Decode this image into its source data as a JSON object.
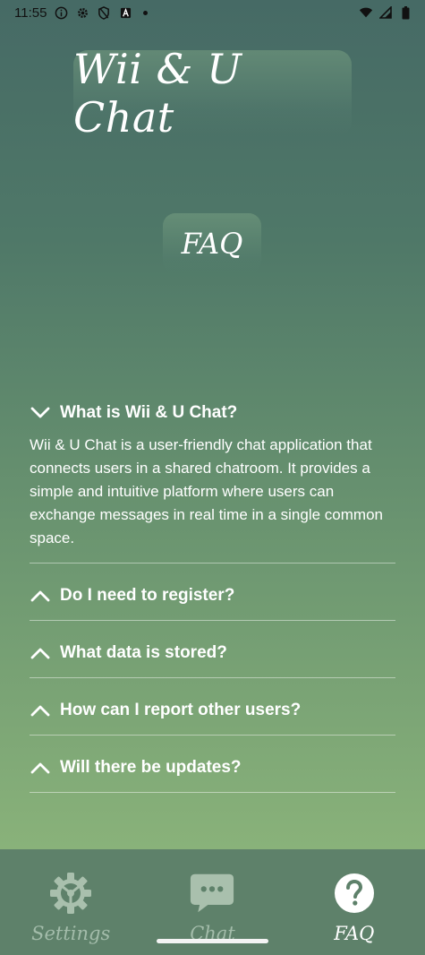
{
  "status_bar": {
    "time": "11:55",
    "left_icons": [
      "info-icon",
      "gear-icon",
      "shield-icon",
      "app-a-icon",
      "dot-icon"
    ],
    "right_icons": [
      "wifi-icon",
      "signal-icon",
      "battery-icon"
    ]
  },
  "header": {
    "app_title": "Wii & U Chat",
    "page_title": "FAQ"
  },
  "faq": {
    "items": [
      {
        "question": "What is Wii & U Chat?",
        "expanded": true,
        "answer": "Wii & U Chat is a user-friendly chat application that connects users in a shared chatroom. It provides a simple and intuitive platform where users can exchange messages in real time in a single common space."
      },
      {
        "question": "Do I need to register?",
        "expanded": false
      },
      {
        "question": "What data is stored?",
        "expanded": false
      },
      {
        "question": "How can I report other users?",
        "expanded": false
      },
      {
        "question": "Will there be updates?",
        "expanded": false
      }
    ]
  },
  "bottom_nav": {
    "items": [
      {
        "label": "Settings",
        "icon": "settings-gear-icon",
        "active": false
      },
      {
        "label": "Chat",
        "icon": "chat-bubble-icon",
        "active": false
      },
      {
        "label": "FAQ",
        "icon": "question-icon",
        "active": true
      }
    ]
  },
  "colors": {
    "nav_background": "#5e816a",
    "gradient_top": "#466a65",
    "gradient_bottom": "#8ab37a",
    "inactive_icon": "#a9c0ad"
  }
}
